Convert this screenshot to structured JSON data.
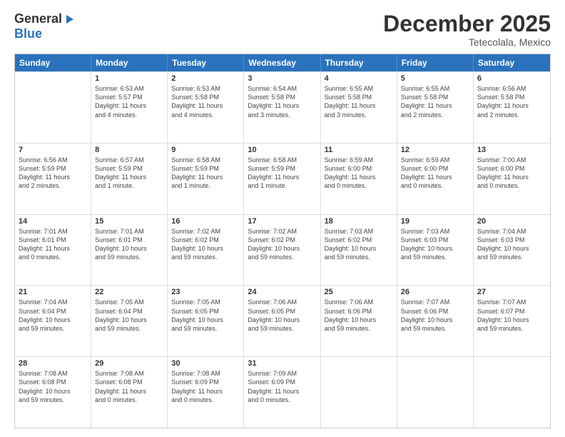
{
  "logo": {
    "line1": "General",
    "line2": "Blue"
  },
  "header": {
    "month": "December 2025",
    "location": "Tetecolala, Mexico"
  },
  "weekdays": [
    "Sunday",
    "Monday",
    "Tuesday",
    "Wednesday",
    "Thursday",
    "Friday",
    "Saturday"
  ],
  "weeks": [
    [
      {
        "day": "",
        "info": ""
      },
      {
        "day": "1",
        "info": "Sunrise: 6:53 AM\nSunset: 5:57 PM\nDaylight: 11 hours\nand 4 minutes."
      },
      {
        "day": "2",
        "info": "Sunrise: 6:53 AM\nSunset: 5:58 PM\nDaylight: 11 hours\nand 4 minutes."
      },
      {
        "day": "3",
        "info": "Sunrise: 6:54 AM\nSunset: 5:58 PM\nDaylight: 11 hours\nand 3 minutes."
      },
      {
        "day": "4",
        "info": "Sunrise: 6:55 AM\nSunset: 5:58 PM\nDaylight: 11 hours\nand 3 minutes."
      },
      {
        "day": "5",
        "info": "Sunrise: 6:55 AM\nSunset: 5:58 PM\nDaylight: 11 hours\nand 2 minutes."
      },
      {
        "day": "6",
        "info": "Sunrise: 6:56 AM\nSunset: 5:58 PM\nDaylight: 11 hours\nand 2 minutes."
      }
    ],
    [
      {
        "day": "7",
        "info": "Sunrise: 6:56 AM\nSunset: 5:59 PM\nDaylight: 11 hours\nand 2 minutes."
      },
      {
        "day": "8",
        "info": "Sunrise: 6:57 AM\nSunset: 5:59 PM\nDaylight: 11 hours\nand 1 minute."
      },
      {
        "day": "9",
        "info": "Sunrise: 6:58 AM\nSunset: 5:59 PM\nDaylight: 11 hours\nand 1 minute."
      },
      {
        "day": "10",
        "info": "Sunrise: 6:58 AM\nSunset: 5:59 PM\nDaylight: 11 hours\nand 1 minute."
      },
      {
        "day": "11",
        "info": "Sunrise: 6:59 AM\nSunset: 6:00 PM\nDaylight: 11 hours\nand 0 minutes."
      },
      {
        "day": "12",
        "info": "Sunrise: 6:59 AM\nSunset: 6:00 PM\nDaylight: 11 hours\nand 0 minutes."
      },
      {
        "day": "13",
        "info": "Sunrise: 7:00 AM\nSunset: 6:00 PM\nDaylight: 11 hours\nand 0 minutes."
      }
    ],
    [
      {
        "day": "14",
        "info": "Sunrise: 7:01 AM\nSunset: 6:01 PM\nDaylight: 11 hours\nand 0 minutes."
      },
      {
        "day": "15",
        "info": "Sunrise: 7:01 AM\nSunset: 6:01 PM\nDaylight: 10 hours\nand 59 minutes."
      },
      {
        "day": "16",
        "info": "Sunrise: 7:02 AM\nSunset: 6:02 PM\nDaylight: 10 hours\nand 59 minutes."
      },
      {
        "day": "17",
        "info": "Sunrise: 7:02 AM\nSunset: 6:02 PM\nDaylight: 10 hours\nand 59 minutes."
      },
      {
        "day": "18",
        "info": "Sunrise: 7:03 AM\nSunset: 6:02 PM\nDaylight: 10 hours\nand 59 minutes."
      },
      {
        "day": "19",
        "info": "Sunrise: 7:03 AM\nSunset: 6:03 PM\nDaylight: 10 hours\nand 59 minutes."
      },
      {
        "day": "20",
        "info": "Sunrise: 7:04 AM\nSunset: 6:03 PM\nDaylight: 10 hours\nand 59 minutes."
      }
    ],
    [
      {
        "day": "21",
        "info": "Sunrise: 7:04 AM\nSunset: 6:04 PM\nDaylight: 10 hours\nand 59 minutes."
      },
      {
        "day": "22",
        "info": "Sunrise: 7:05 AM\nSunset: 6:04 PM\nDaylight: 10 hours\nand 59 minutes."
      },
      {
        "day": "23",
        "info": "Sunrise: 7:05 AM\nSunset: 6:05 PM\nDaylight: 10 hours\nand 59 minutes."
      },
      {
        "day": "24",
        "info": "Sunrise: 7:06 AM\nSunset: 6:05 PM\nDaylight: 10 hours\nand 59 minutes."
      },
      {
        "day": "25",
        "info": "Sunrise: 7:06 AM\nSunset: 6:06 PM\nDaylight: 10 hours\nand 59 minutes."
      },
      {
        "day": "26",
        "info": "Sunrise: 7:07 AM\nSunset: 6:06 PM\nDaylight: 10 hours\nand 59 minutes."
      },
      {
        "day": "27",
        "info": "Sunrise: 7:07 AM\nSunset: 6:07 PM\nDaylight: 10 hours\nand 59 minutes."
      }
    ],
    [
      {
        "day": "28",
        "info": "Sunrise: 7:08 AM\nSunset: 6:08 PM\nDaylight: 10 hours\nand 59 minutes."
      },
      {
        "day": "29",
        "info": "Sunrise: 7:08 AM\nSunset: 6:08 PM\nDaylight: 11 hours\nand 0 minutes."
      },
      {
        "day": "30",
        "info": "Sunrise: 7:08 AM\nSunset: 6:09 PM\nDaylight: 11 hours\nand 0 minutes."
      },
      {
        "day": "31",
        "info": "Sunrise: 7:09 AM\nSunset: 6:09 PM\nDaylight: 11 hours\nand 0 minutes."
      },
      {
        "day": "",
        "info": ""
      },
      {
        "day": "",
        "info": ""
      },
      {
        "day": "",
        "info": ""
      }
    ]
  ]
}
